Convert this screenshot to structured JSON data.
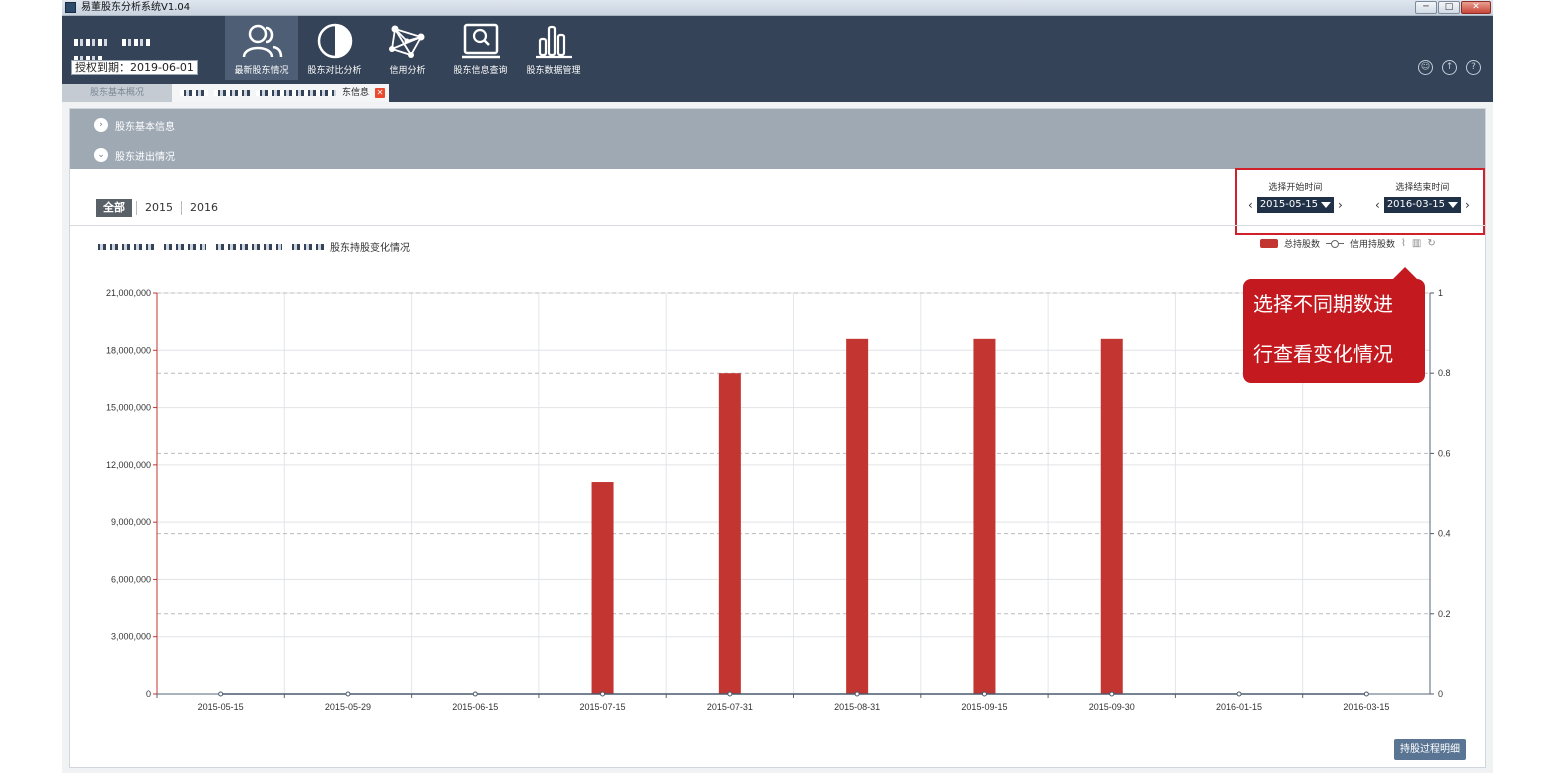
{
  "window": {
    "title": "易董股东分析系统V1.04",
    "buttons": [
      "─",
      "□",
      "✕"
    ]
  },
  "header": {
    "license_expiry": "授权到期：2019-06-01",
    "nav": [
      {
        "label": "最新股东情况",
        "icon": "users-icon",
        "active": true
      },
      {
        "label": "股东对比分析",
        "icon": "half-circle-icon",
        "active": false
      },
      {
        "label": "信用分析",
        "icon": "network-icon",
        "active": false
      },
      {
        "label": "股东信息查询",
        "icon": "search-monitor-icon",
        "active": false
      },
      {
        "label": "股东数据管理",
        "icon": "bar-chart-icon",
        "active": false
      }
    ],
    "right_icons": [
      "user-icon",
      "upload-icon",
      "help-icon"
    ]
  },
  "tabs": [
    {
      "label": "股东基本概况",
      "active": false
    },
    {
      "label": "东信息",
      "active": true
    }
  ],
  "accordion": [
    {
      "label": "股东基本信息",
      "icon": "chevron-right-icon"
    },
    {
      "label": "股东进出情况",
      "icon": "chevron-down-icon"
    }
  ],
  "year_filter": {
    "items": [
      "全部",
      "2015",
      "2016"
    ],
    "selected": "全部"
  },
  "date_range": {
    "start_label": "选择开始时间",
    "start_value": "2015-05-15",
    "end_label": "选择结束时间",
    "end_value": "2016-03-15"
  },
  "chart_title_suffix": "股东持股变化情况",
  "callout": {
    "line1": "选择不同期数进",
    "line2": "行查看变化情况"
  },
  "detail_button": "持股过程明细",
  "colors": {
    "bar": "#c23531",
    "header": "#344357",
    "callout": "#c3191f"
  },
  "chart_data": {
    "type": "bar",
    "categories": [
      "2015-05-15",
      "2015-05-29",
      "2015-06-15",
      "2015-07-15",
      "2015-07-31",
      "2015-08-31",
      "2015-09-15",
      "2015-09-30",
      "2016-01-15",
      "2016-03-15"
    ],
    "series": [
      {
        "name": "总持股数",
        "type": "bar",
        "axis": "left",
        "values": [
          0,
          0,
          0,
          11100000,
          16800000,
          18600000,
          18600000,
          18600000,
          0,
          0
        ]
      },
      {
        "name": "信用持股数",
        "type": "line",
        "axis": "right",
        "values": [
          0,
          0,
          0,
          0,
          0,
          0,
          0,
          0,
          0,
          0
        ]
      }
    ],
    "y_left": {
      "min": 0,
      "max": 21000000,
      "ticks": [
        0,
        3000000,
        6000000,
        9000000,
        12000000,
        15000000,
        18000000,
        21000000
      ],
      "tick_labels": [
        "0",
        "3,000,000",
        "6,000,000",
        "9,000,000",
        "12,000,000",
        "15,000,000",
        "18,000,000",
        "21,000,000"
      ]
    },
    "y_right": {
      "min": 0,
      "max": 1,
      "ticks": [
        0,
        0.2,
        0.4,
        0.6,
        0.8,
        1
      ],
      "tick_labels": [
        "0",
        "0.2",
        "0.4",
        "0.6",
        "0.8",
        "1"
      ]
    },
    "grid": true,
    "legend": "top-right"
  }
}
